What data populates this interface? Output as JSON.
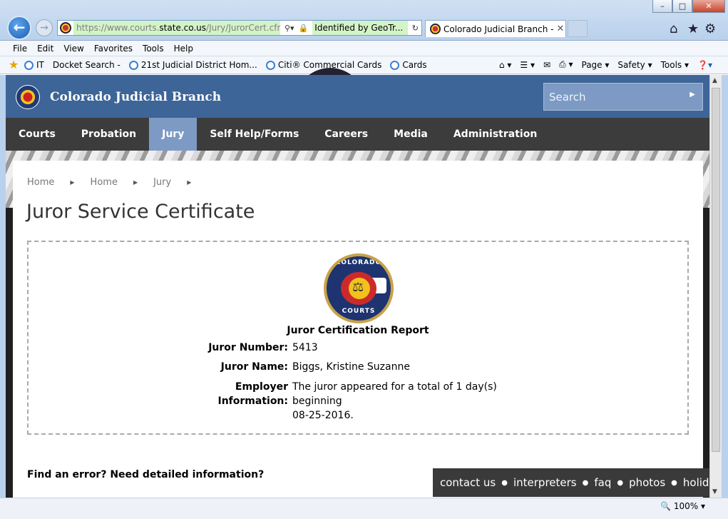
{
  "browser": {
    "window_controls": {
      "minimize": "–",
      "maximize": "□",
      "close": "✕"
    },
    "address": {
      "url_prefix": "https://www.courts.",
      "url_host": "state.co.us",
      "url_path": "/Jury/JurorCert.cfm",
      "identified": "Identified by GeoTr..."
    },
    "tab_title": "Colorado Judicial Branch - J...",
    "menu": [
      "File",
      "Edit",
      "View",
      "Favorites",
      "Tools",
      "Help"
    ],
    "favorites": [
      "IT",
      "Docket Search -",
      "21st Judicial District Hom...",
      "Citi® Commercial Cards",
      "Cards"
    ],
    "commands": [
      "Page ▾",
      "Safety ▾",
      "Tools ▾"
    ],
    "zoom": "100%"
  },
  "site": {
    "brand": "Colorado Judicial Branch",
    "search_placeholder": "Search",
    "nav": [
      "Courts",
      "Probation",
      "Jury",
      "Self Help/Forms",
      "Careers",
      "Media",
      "Administration"
    ],
    "active_nav": "Jury"
  },
  "page": {
    "breadcrumbs": [
      "Home",
      "Home",
      "Jury"
    ],
    "title": "Juror Service Certificate",
    "seal_top": "COLORADO",
    "seal_bottom": "COURTS",
    "report_title": "Juror Certification Report",
    "juror_number_label": "Juror Number:",
    "juror_number": "5413",
    "juror_name_label": "Juror Name:",
    "juror_name": "Biggs, Kristine Suzanne",
    "employer_label_1": "Employer",
    "employer_label_2": "Information:",
    "employer_line_1": "The juror appeared for a total of 1 day(s)",
    "employer_line_2": "beginning",
    "employer_line_3": "08-25-2016.",
    "help_question": "Find an error? Need detailed information?"
  },
  "footer": {
    "links": [
      "contact us",
      "interpreters",
      "faq",
      "photos",
      "holidays"
    ]
  },
  "colors": {
    "header_blue": "#3d6597",
    "nav_dark": "#3c3c3c",
    "nav_active": "#7d9ac4"
  },
  "icons": [
    "back-arrow-icon",
    "forward-arrow-icon",
    "lock-icon",
    "refresh-icon",
    "home-icon",
    "star-icon",
    "gear-icon",
    "print-icon",
    "rss-icon",
    "mail-icon",
    "help-icon"
  ]
}
